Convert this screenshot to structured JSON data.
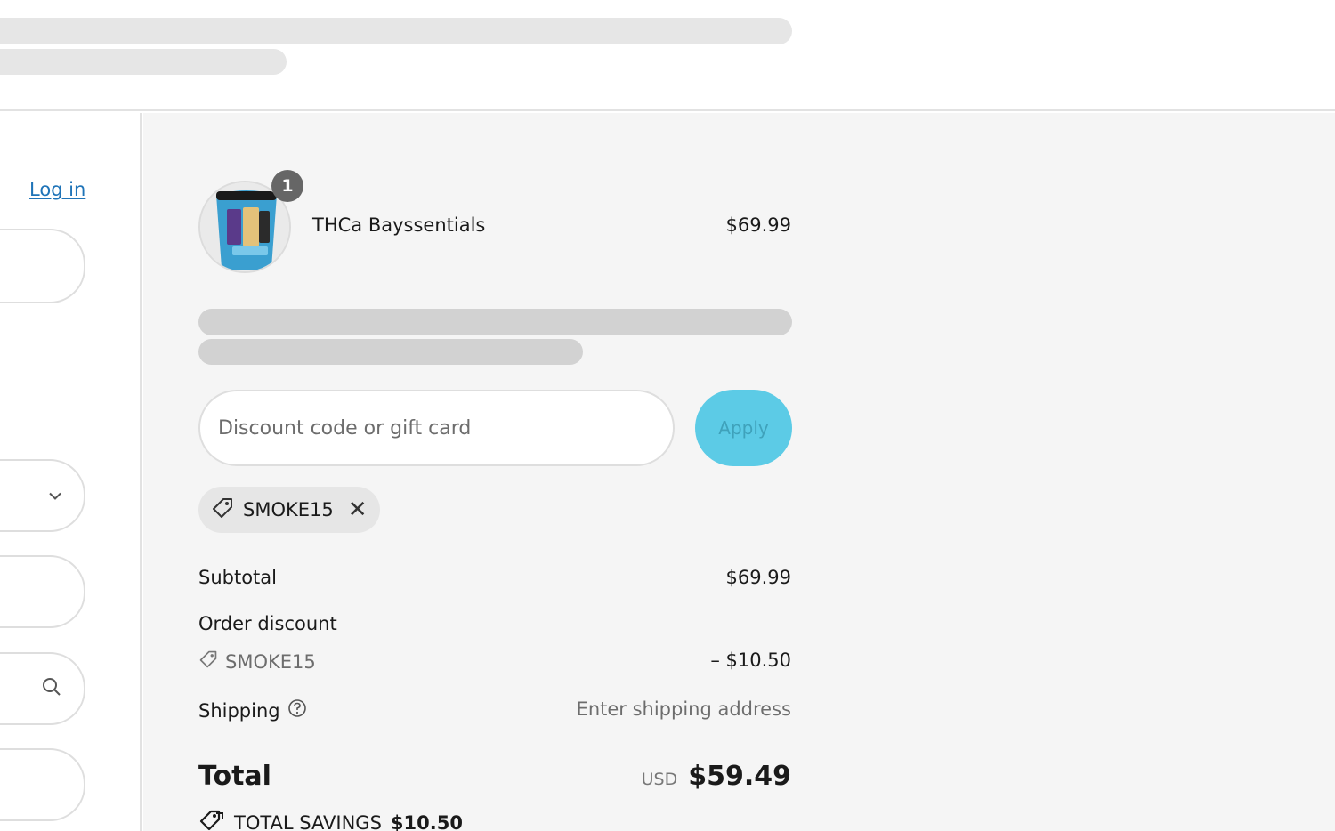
{
  "header": {
    "loading": true
  },
  "left": {
    "login_label": "Log in"
  },
  "product": {
    "name": "THCa Bayssentials",
    "price": "$69.99",
    "quantity": "1"
  },
  "discount": {
    "placeholder": "Discount code or gift card",
    "apply_label": "Apply",
    "applied_code": "SMOKE15"
  },
  "summary": {
    "subtotal_label": "Subtotal",
    "subtotal_value": "$69.99",
    "order_discount_label": "Order discount",
    "discount_code": "SMOKE15",
    "discount_value": "– $10.50",
    "shipping_label": "Shipping",
    "shipping_value": "Enter shipping address",
    "total_label": "Total",
    "currency": "USD",
    "total_value": "$59.49",
    "savings_label": "TOTAL SAVINGS",
    "savings_value": "$10.50"
  },
  "colors": {
    "accent": "#5ccbe6",
    "link": "#1f74b8",
    "summary_bg": "#f5f5f5"
  }
}
